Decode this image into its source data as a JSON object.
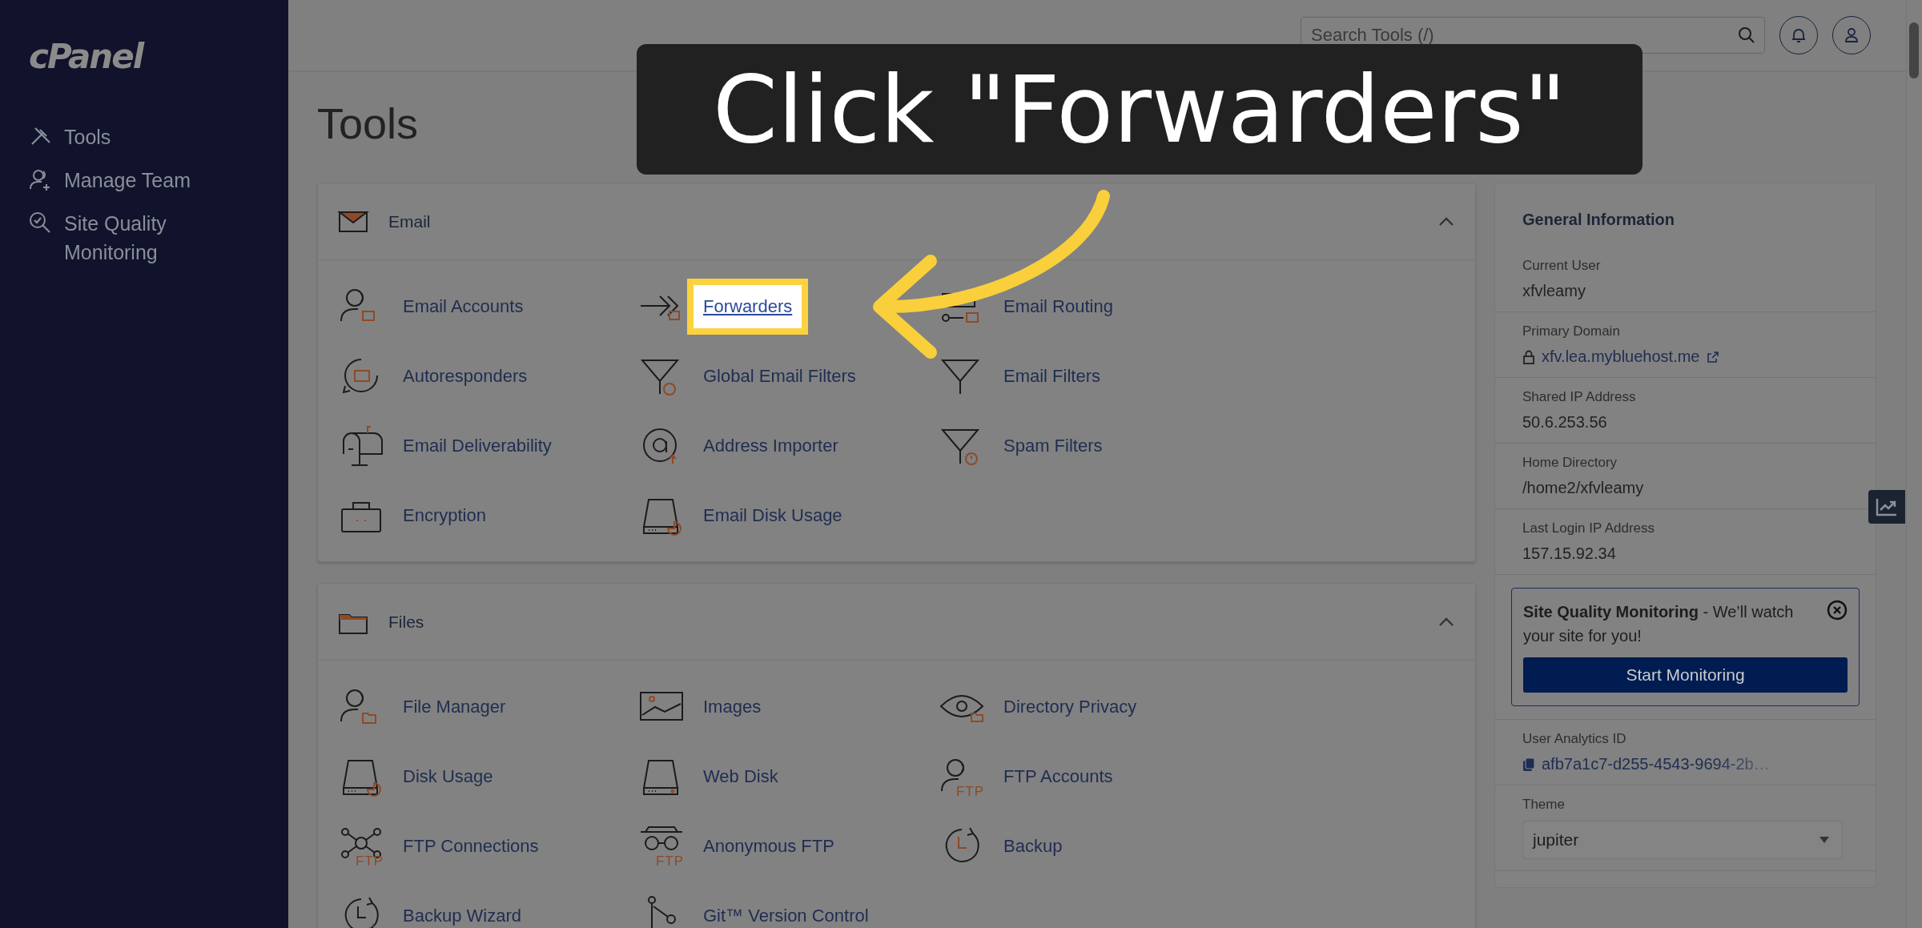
{
  "sidebar": {
    "logo": "cPanel",
    "items": [
      {
        "label": "Tools"
      },
      {
        "label": "Manage Team"
      },
      {
        "label": "Site Quality Monitoring"
      }
    ]
  },
  "header": {
    "search": {
      "placeholder": "Search Tools (/)"
    }
  },
  "page_title": "Tools",
  "sections": [
    {
      "title": "Email",
      "expanded": true,
      "items": [
        {
          "label": "Email Accounts",
          "highlighted": false
        },
        {
          "label": "Forwarders",
          "highlighted": true
        },
        {
          "label": "Email Routing",
          "highlighted": false
        },
        {
          "label": "Autoresponders",
          "highlighted": false
        },
        {
          "label": "Global Email Filters",
          "highlighted": false
        },
        {
          "label": "Email Filters",
          "highlighted": false
        },
        {
          "label": "Email Deliverability",
          "highlighted": false
        },
        {
          "label": "Address Importer",
          "highlighted": false
        },
        {
          "label": "Spam Filters",
          "highlighted": false
        },
        {
          "label": "Encryption",
          "highlighted": false
        },
        {
          "label": "Email Disk Usage",
          "highlighted": false
        }
      ]
    },
    {
      "title": "Files",
      "expanded": true,
      "items": [
        {
          "label": "File Manager",
          "highlighted": false
        },
        {
          "label": "Images",
          "highlighted": false
        },
        {
          "label": "Directory Privacy",
          "highlighted": false
        },
        {
          "label": "Disk Usage",
          "highlighted": false
        },
        {
          "label": "Web Disk",
          "highlighted": false
        },
        {
          "label": "FTP Accounts",
          "highlighted": false,
          "icon_text": "FTP"
        },
        {
          "label": "FTP Connections",
          "highlighted": false,
          "icon_text": "FTP"
        },
        {
          "label": "Anonymous FTP",
          "highlighted": false,
          "icon_text": "FTP"
        },
        {
          "label": "Backup",
          "highlighted": false
        },
        {
          "label": "Backup Wizard",
          "highlighted": false
        },
        {
          "label": "Git™ Version Control",
          "highlighted": false
        }
      ]
    }
  ],
  "general_info": {
    "title": "General Information",
    "rows": [
      {
        "kind": "text",
        "label": "Current User",
        "value": "xfvleamy"
      },
      {
        "kind": "link",
        "label": "Primary Domain",
        "value": "xfv.lea.mybluehost.me"
      },
      {
        "kind": "text",
        "label": "Shared IP Address",
        "value": "50.6.253.56"
      },
      {
        "kind": "text",
        "label": "Home Directory",
        "value": "/home2/xfvleamy"
      },
      {
        "kind": "text",
        "label": "Last Login IP Address",
        "value": "157.15.92.34"
      },
      {
        "kind": "promo",
        "text": "**Site Quality Monitoring** - We’ll watch your site for you!",
        "button": "Start Monitoring"
      },
      {
        "kind": "copy",
        "label": "User Analytics ID",
        "value": "afb7a1c7-d255-4543-9694-2b…"
      },
      {
        "kind": "select",
        "label": "Theme",
        "value": "jupiter"
      }
    ]
  },
  "annotation": {
    "text": "Click \"Forwarders\""
  }
}
